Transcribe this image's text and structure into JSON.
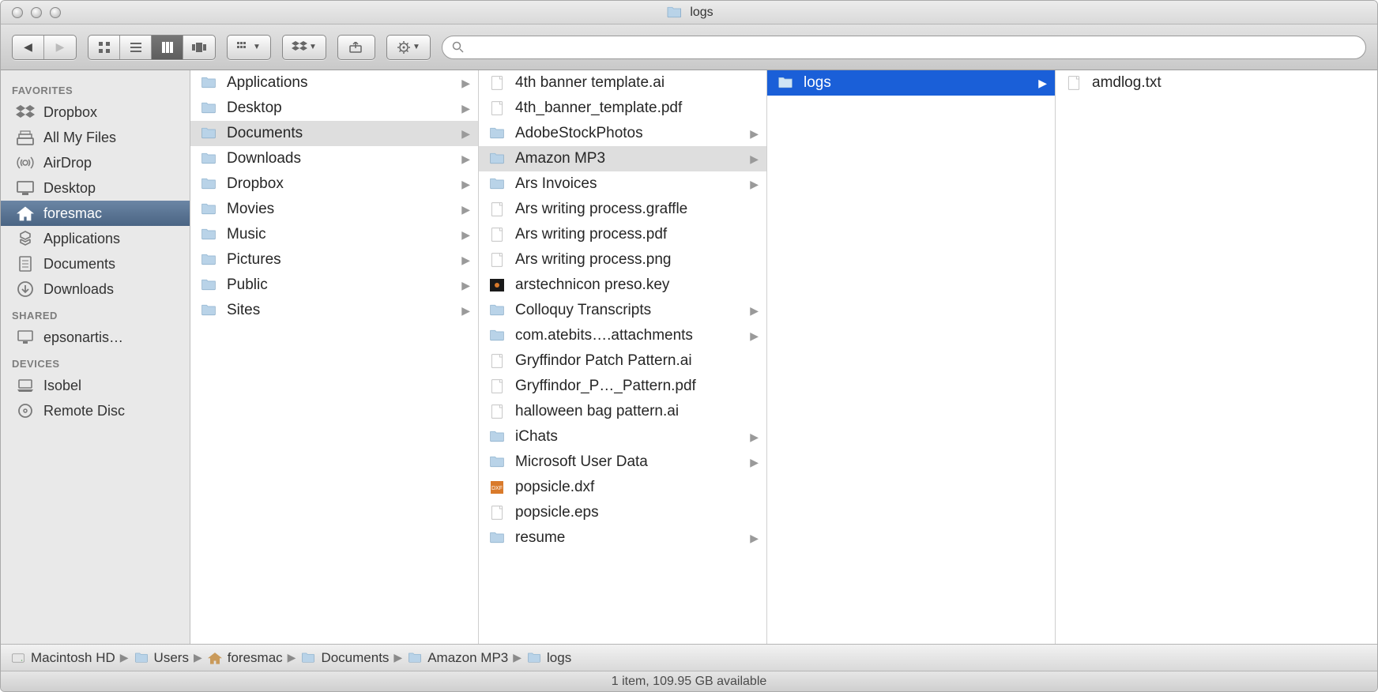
{
  "window_title": "logs",
  "sidebar": {
    "sections": [
      {
        "heading": "FAVORITES",
        "items": [
          {
            "label": "Dropbox",
            "icon": "dropbox",
            "selected": false
          },
          {
            "label": "All My Files",
            "icon": "allfiles",
            "selected": false
          },
          {
            "label": "AirDrop",
            "icon": "airdrop",
            "selected": false
          },
          {
            "label": "Desktop",
            "icon": "desktop",
            "selected": false
          },
          {
            "label": "foresmac",
            "icon": "home",
            "selected": true
          },
          {
            "label": "Applications",
            "icon": "apps",
            "selected": false
          },
          {
            "label": "Documents",
            "icon": "docs",
            "selected": false
          },
          {
            "label": "Downloads",
            "icon": "downloads",
            "selected": false
          }
        ]
      },
      {
        "heading": "SHARED",
        "items": [
          {
            "label": "epsonartis…",
            "icon": "computer",
            "selected": false
          }
        ]
      },
      {
        "heading": "DEVICES",
        "items": [
          {
            "label": "Isobel",
            "icon": "laptop",
            "selected": false
          },
          {
            "label": "Remote Disc",
            "icon": "disc",
            "selected": false
          }
        ]
      }
    ]
  },
  "columns": [
    [
      {
        "label": "Applications",
        "type": "folder-apps",
        "arrow": true,
        "state": ""
      },
      {
        "label": "Desktop",
        "type": "folder",
        "arrow": true,
        "state": ""
      },
      {
        "label": "Documents",
        "type": "folder",
        "arrow": true,
        "state": "hl"
      },
      {
        "label": "Downloads",
        "type": "folder",
        "arrow": true,
        "state": ""
      },
      {
        "label": "Dropbox",
        "type": "folder",
        "arrow": true,
        "state": ""
      },
      {
        "label": "Movies",
        "type": "folder",
        "arrow": true,
        "state": ""
      },
      {
        "label": "Music",
        "type": "folder",
        "arrow": true,
        "state": ""
      },
      {
        "label": "Pictures",
        "type": "folder",
        "arrow": true,
        "state": ""
      },
      {
        "label": "Public",
        "type": "folder",
        "arrow": true,
        "state": ""
      },
      {
        "label": "Sites",
        "type": "folder",
        "arrow": true,
        "state": ""
      }
    ],
    [
      {
        "label": "4th banner template.ai",
        "type": "file",
        "arrow": false,
        "state": ""
      },
      {
        "label": "4th_banner_template.pdf",
        "type": "pdf",
        "arrow": false,
        "state": ""
      },
      {
        "label": "AdobeStockPhotos",
        "type": "folder",
        "arrow": true,
        "state": ""
      },
      {
        "label": "Amazon MP3",
        "type": "folder",
        "arrow": true,
        "state": "hl"
      },
      {
        "label": "Ars Invoices",
        "type": "folder",
        "arrow": true,
        "state": ""
      },
      {
        "label": "Ars writing process.graffle",
        "type": "graffle",
        "arrow": false,
        "state": ""
      },
      {
        "label": "Ars writing process.pdf",
        "type": "pdf",
        "arrow": false,
        "state": ""
      },
      {
        "label": "Ars writing process.png",
        "type": "png",
        "arrow": false,
        "state": ""
      },
      {
        "label": "arstechnicon preso.key",
        "type": "key",
        "arrow": false,
        "state": ""
      },
      {
        "label": "Colloquy Transcripts",
        "type": "folder",
        "arrow": true,
        "state": ""
      },
      {
        "label": "com.atebits….attachments",
        "type": "folder",
        "arrow": true,
        "state": ""
      },
      {
        "label": "Gryffindor Patch Pattern.ai",
        "type": "file",
        "arrow": false,
        "state": ""
      },
      {
        "label": "Gryffindor_P…_Pattern.pdf",
        "type": "pdf",
        "arrow": false,
        "state": ""
      },
      {
        "label": "halloween bag pattern.ai",
        "type": "file",
        "arrow": false,
        "state": ""
      },
      {
        "label": "iChats",
        "type": "folder",
        "arrow": true,
        "state": ""
      },
      {
        "label": "Microsoft User Data",
        "type": "folder",
        "arrow": true,
        "state": ""
      },
      {
        "label": "popsicle.dxf",
        "type": "dxf",
        "arrow": false,
        "state": ""
      },
      {
        "label": "popsicle.eps",
        "type": "file",
        "arrow": false,
        "state": ""
      },
      {
        "label": "resume",
        "type": "folder",
        "arrow": true,
        "state": ""
      }
    ],
    [
      {
        "label": "logs",
        "type": "folder",
        "arrow": true,
        "state": "sel"
      }
    ],
    [
      {
        "label": "amdlog.txt",
        "type": "file",
        "arrow": false,
        "state": ""
      }
    ]
  ],
  "path": [
    {
      "label": "Macintosh HD",
      "icon": "hdd"
    },
    {
      "label": "Users",
      "icon": "folder"
    },
    {
      "label": "foresmac",
      "icon": "home"
    },
    {
      "label": "Documents",
      "icon": "folder"
    },
    {
      "label": "Amazon MP3",
      "icon": "folder"
    },
    {
      "label": "logs",
      "icon": "folder"
    }
  ],
  "status": "1 item, 109.95 GB available"
}
